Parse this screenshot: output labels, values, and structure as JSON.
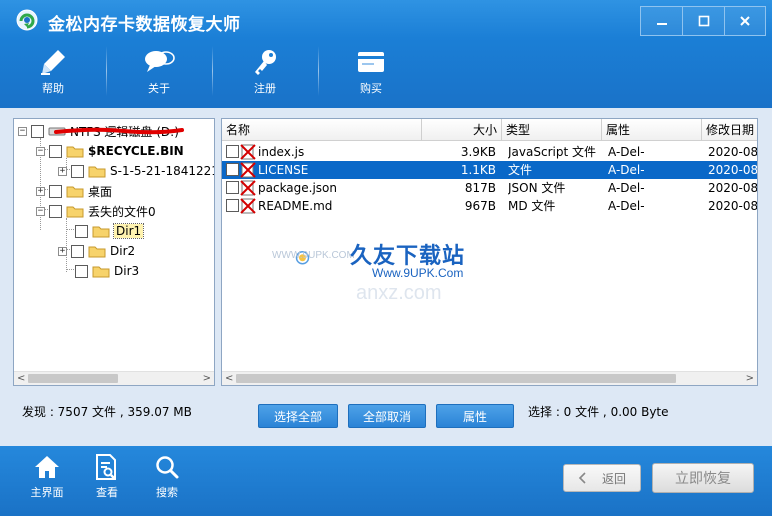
{
  "window": {
    "title": "金松内存卡数据恢复大师",
    "controls": [
      "minimize",
      "maximize",
      "close"
    ]
  },
  "toolbar": {
    "items": [
      {
        "label": "帮助",
        "icon": "help-pen-icon"
      },
      {
        "label": "关于",
        "icon": "chat-bubble-icon"
      },
      {
        "label": "注册",
        "icon": "key-icon"
      },
      {
        "label": "购买",
        "icon": "card-icon"
      }
    ]
  },
  "tree": {
    "root": "NTFS 逻辑磁盘 (D:)",
    "items": [
      {
        "label": "$RECYCLE.BIN",
        "expander": "−"
      },
      {
        "label": "S-1-5-21-1841221",
        "expander": "+"
      },
      {
        "label": "桌面",
        "expander": "+"
      },
      {
        "label": "丢失的文件0",
        "expander": "−"
      },
      {
        "label": "Dir1",
        "expander": ""
      },
      {
        "label": "Dir2",
        "expander": "+"
      },
      {
        "label": "Dir3",
        "expander": ""
      }
    ]
  },
  "list": {
    "columns": [
      "名称",
      "大小",
      "类型",
      "属性",
      "修改日期"
    ],
    "rows": [
      {
        "name": "index.js",
        "size": "3.9KB",
        "type": "JavaScript 文件",
        "attr": "A-Del-",
        "date": "2020-08-"
      },
      {
        "name": "LICENSE",
        "size": "1.1KB",
        "type": "文件",
        "attr": "A-Del-",
        "date": "2020-08-"
      },
      {
        "name": "package.json",
        "size": "817B",
        "type": "JSON 文件",
        "attr": "A-Del-",
        "date": "2020-08-"
      },
      {
        "name": "README.md",
        "size": "967B",
        "type": "MD 文件",
        "attr": "A-Del-",
        "date": "2020-08-"
      }
    ],
    "selected_row": 1
  },
  "status": {
    "found": "发现 : 7507 文件 , 359.07 MB",
    "selected": "选择 : 0 文件 , 0.00 Byte"
  },
  "buttons": {
    "select_all": "选择全部",
    "deselect_all": "全部取消",
    "properties": "属性",
    "back": "返回",
    "recover": "立即恢复"
  },
  "footer_nav": [
    {
      "label": "主界面",
      "icon": "home-icon"
    },
    {
      "label": "查看",
      "icon": "document-search-icon"
    },
    {
      "label": "搜索",
      "icon": "search-icon"
    }
  ],
  "watermark": {
    "brand": "久友下载站",
    "url": "Www.9UPK.Com",
    "www": "WWW.9UPK.COM",
    "faint": "anxz.com"
  },
  "colors": {
    "title_bar": "#1b7fd6",
    "selection": "#0a68c8",
    "panel_bg": "#dde8f5",
    "button_blue": "#2a83d6"
  }
}
